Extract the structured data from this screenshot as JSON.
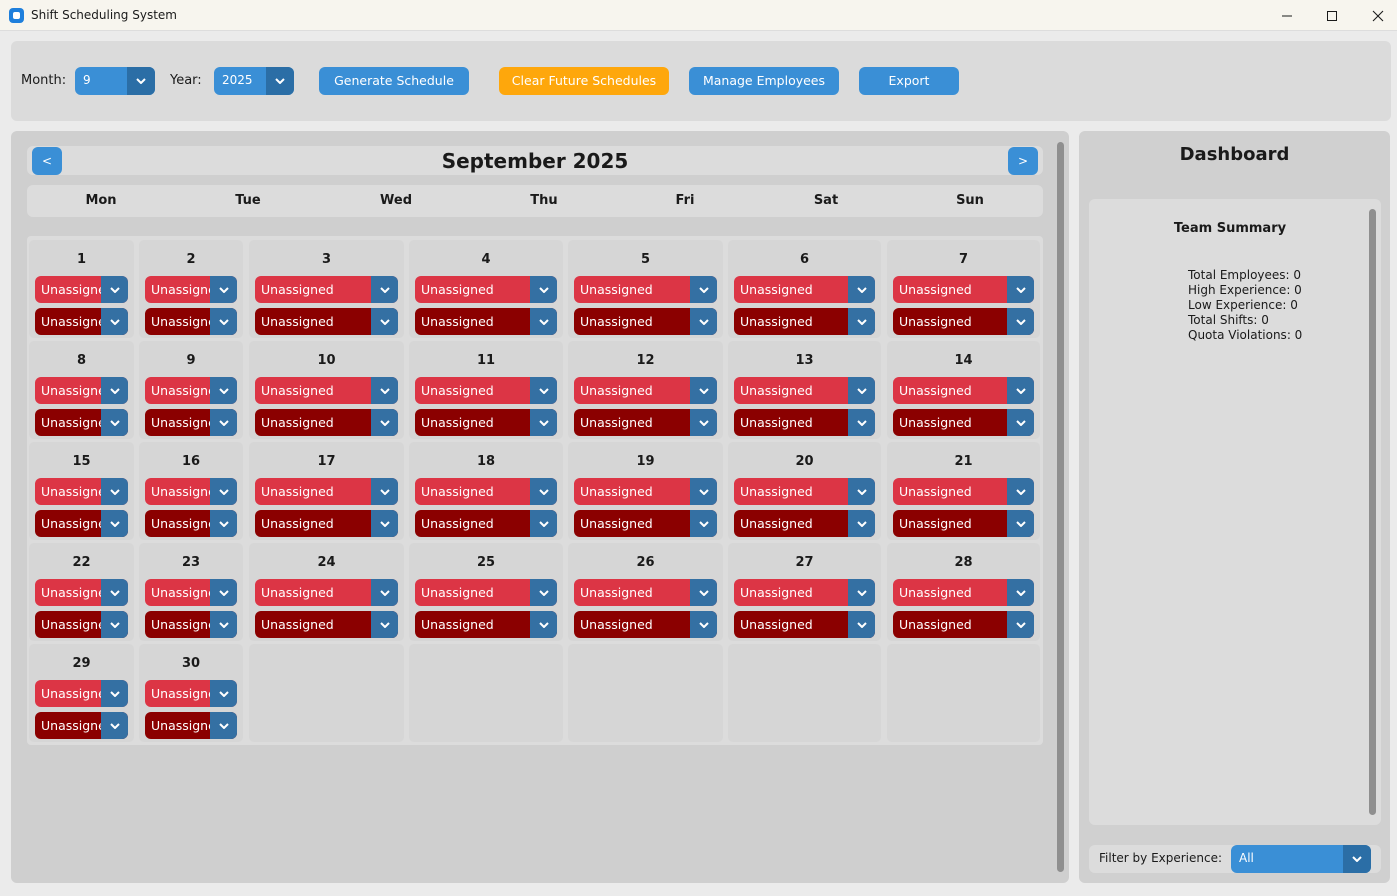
{
  "window": {
    "title": "Shift Scheduling System"
  },
  "controls": {
    "month_label": "Month:",
    "month_value": "9",
    "year_label": "Year:",
    "year_value": "2025",
    "generate_label": "Generate Schedule",
    "clear_label": "Clear Future Schedules",
    "manage_label": "Manage Employees",
    "export_label": "Export"
  },
  "calendar": {
    "title": "September 2025",
    "prev_label": "<",
    "next_label": ">",
    "weekdays": [
      "Mon",
      "Tue",
      "Wed",
      "Thu",
      "Fri",
      "Sat",
      "Sun"
    ],
    "days": [
      {
        "day": "1",
        "shift1": "Unassigned",
        "shift2": "Unassigned"
      },
      {
        "day": "2",
        "shift1": "Unassigned",
        "shift2": "Unassigned"
      },
      {
        "day": "3",
        "shift1": "Unassigned",
        "shift2": "Unassigned"
      },
      {
        "day": "4",
        "shift1": "Unassigned",
        "shift2": "Unassigned"
      },
      {
        "day": "5",
        "shift1": "Unassigned",
        "shift2": "Unassigned"
      },
      {
        "day": "6",
        "shift1": "Unassigned",
        "shift2": "Unassigned"
      },
      {
        "day": "7",
        "shift1": "Unassigned",
        "shift2": "Unassigned"
      },
      {
        "day": "8",
        "shift1": "Unassigned",
        "shift2": "Unassigned"
      },
      {
        "day": "9",
        "shift1": "Unassigned",
        "shift2": "Unassigned"
      },
      {
        "day": "10",
        "shift1": "Unassigned",
        "shift2": "Unassigned"
      },
      {
        "day": "11",
        "shift1": "Unassigned",
        "shift2": "Unassigned"
      },
      {
        "day": "12",
        "shift1": "Unassigned",
        "shift2": "Unassigned"
      },
      {
        "day": "13",
        "shift1": "Unassigned",
        "shift2": "Unassigned"
      },
      {
        "day": "14",
        "shift1": "Unassigned",
        "shift2": "Unassigned"
      },
      {
        "day": "15",
        "shift1": "Unassigned",
        "shift2": "Unassigned"
      },
      {
        "day": "16",
        "shift1": "Unassigned",
        "shift2": "Unassigned"
      },
      {
        "day": "17",
        "shift1": "Unassigned",
        "shift2": "Unassigned"
      },
      {
        "day": "18",
        "shift1": "Unassigned",
        "shift2": "Unassigned"
      },
      {
        "day": "19",
        "shift1": "Unassigned",
        "shift2": "Unassigned"
      },
      {
        "day": "20",
        "shift1": "Unassigned",
        "shift2": "Unassigned"
      },
      {
        "day": "21",
        "shift1": "Unassigned",
        "shift2": "Unassigned"
      },
      {
        "day": "22",
        "shift1": "Unassigned",
        "shift2": "Unassigned"
      },
      {
        "day": "23",
        "shift1": "Unassigned",
        "shift2": "Unassigned"
      },
      {
        "day": "24",
        "shift1": "Unassigned",
        "shift2": "Unassigned"
      },
      {
        "day": "25",
        "shift1": "Unassigned",
        "shift2": "Unassigned"
      },
      {
        "day": "26",
        "shift1": "Unassigned",
        "shift2": "Unassigned"
      },
      {
        "day": "27",
        "shift1": "Unassigned",
        "shift2": "Unassigned"
      },
      {
        "day": "28",
        "shift1": "Unassigned",
        "shift2": "Unassigned"
      },
      {
        "day": "29",
        "shift1": "Unassigned",
        "shift2": "Unassigned"
      },
      {
        "day": "30",
        "shift1": "Unassigned",
        "shift2": "Unassigned"
      }
    ]
  },
  "dashboard": {
    "title": "Dashboard",
    "team_summary_title": "Team Summary",
    "stats": [
      "Total Employees: 0",
      "High Experience: 0",
      "Low Experience: 0",
      "Total Shifts: 0",
      "Quota Violations: 0"
    ],
    "filter_label": "Filter by Experience:",
    "filter_value": "All"
  },
  "colors": {
    "primary_button": "#3a8fd6",
    "warning_button": "#fea70c",
    "shift1_unassigned": "#dc3545",
    "shift2_unassigned": "#8b0000",
    "dropdown_arrow": "#3470a3"
  },
  "icons": {
    "app": "app-icon",
    "minimize": "minimize-icon",
    "maximize": "maximize-icon",
    "close": "close-icon",
    "dropdown": "chevron-down-icon"
  }
}
